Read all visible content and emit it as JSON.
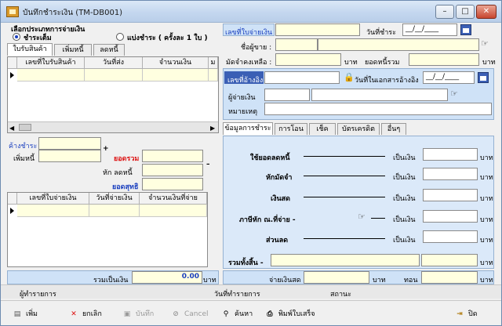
{
  "window": {
    "title": "บันทึกชำระเงิน (TM-DB001)",
    "minimize": "–",
    "maximize": "□",
    "close": "✕"
  },
  "payment_type": {
    "label": "เลือกประเภทการจ่ายเงิน",
    "option_full": "ชำระเต็ม",
    "option_installment": "แบ่งชำระ  ( ครั้งละ 1 ใบ )"
  },
  "left_tabs": [
    "ใบรับสินค้า",
    "เพิ่มหนี้",
    "ลดหนี้"
  ],
  "receipts_grid": {
    "columns": [
      "เลขที่ใบรับสินค้า",
      "วันที่ส่ง",
      "จำนวนเงิน",
      "ม"
    ]
  },
  "summary": {
    "outstanding_label": "ค้างชำระ",
    "add_debt_label": "เพิ่มหนี้",
    "plus": "+",
    "total_label": "ยอดรวม",
    "minus": "–",
    "deduct_label": "หัก  ลดหนี้",
    "net_label": "ยอดสุทธิ"
  },
  "payments_grid": {
    "columns": [
      "เลขที่ใบจ่ายเงิน",
      "วันที่จ่ายเงิน",
      "จำนวนเงินที่จ่าย"
    ]
  },
  "total_row": {
    "label": "รวมเป็นเงิน",
    "value": "0.00",
    "unit": "บาท"
  },
  "header_form": {
    "payment_no_label": "เลขที่ใบจ่ายเงิน",
    "date_label": "วันที่ชำระ",
    "date_value": "__/__/____",
    "seller_label": "ชื่อผู้ขาย :",
    "deposit_label": "มัดจำคงเหลือ :",
    "baht": "บาท",
    "debt_total_label": "ยอดหนี้รวม"
  },
  "reference_form": {
    "ref_no_label": "เลขที่อ้างอิง",
    "ref_date_label": "วันที่ในเอกสารอ้างอิง",
    "ref_date_value": "__/__/____",
    "payer_label": "ผู้จ่ายเงิน",
    "note_label": "หมายเหตุ"
  },
  "right_tabs": [
    "ข้อมูลการชำระ",
    "การโอน",
    "เช็ค",
    "บัตรเครดิต",
    "อื่นๆ"
  ],
  "payment_info": {
    "rows": [
      {
        "label": "ใช้ยอดลดหนี้",
        "as": "เป็นเงิน",
        "unit": "บาท"
      },
      {
        "label": "หักมัดจำ",
        "as": "เป็นเงิน",
        "unit": "บาท"
      },
      {
        "label": "เงินสด",
        "as": "เป็นเงิน",
        "unit": "บาท"
      },
      {
        "label": "ภาษีหัก ณ.ที่จ่าย  -",
        "as": "เป็นเงิน",
        "unit": "บาท"
      },
      {
        "label": "ส่วนลด",
        "as": "เป็นเงิน",
        "unit": "บาท"
      }
    ],
    "grand_total_label": "รวมทั้งสิ้น  -",
    "grand_total_unit": "บาท"
  },
  "cash_row": {
    "paid_label": "จ่ายเงินสด",
    "baht1": "บาท",
    "change_label": "ทอน",
    "baht2": "บาท"
  },
  "status_bar": {
    "operator_label": "ผู้ทำรายการ",
    "op_date_label": "วันที่ทำรายการ",
    "status_label": "สถานะ"
  },
  "toolbar": {
    "add": "เพิ่ม",
    "cancel_doc": "ยกเลิก",
    "save": "บันทึก",
    "cancel": "Cancel",
    "search": "ค้นหา",
    "print": "พิมพ์ใบเสร็จ",
    "close": "ปิด"
  }
}
